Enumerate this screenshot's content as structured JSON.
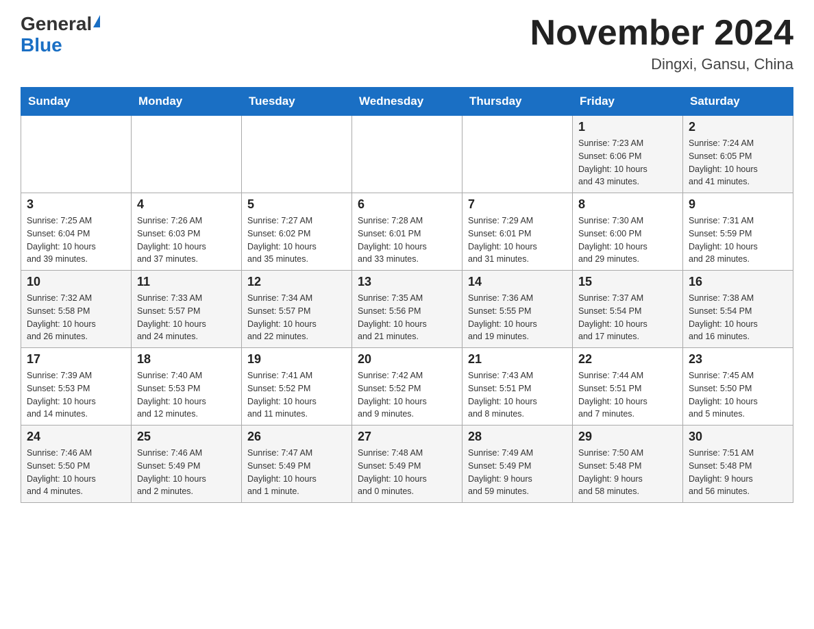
{
  "header": {
    "logo_general": "General",
    "logo_blue": "Blue",
    "month_title": "November 2024",
    "location": "Dingxi, Gansu, China"
  },
  "weekdays": [
    "Sunday",
    "Monday",
    "Tuesday",
    "Wednesday",
    "Thursday",
    "Friday",
    "Saturday"
  ],
  "weeks": [
    [
      {
        "day": "",
        "info": ""
      },
      {
        "day": "",
        "info": ""
      },
      {
        "day": "",
        "info": ""
      },
      {
        "day": "",
        "info": ""
      },
      {
        "day": "",
        "info": ""
      },
      {
        "day": "1",
        "info": "Sunrise: 7:23 AM\nSunset: 6:06 PM\nDaylight: 10 hours\nand 43 minutes."
      },
      {
        "day": "2",
        "info": "Sunrise: 7:24 AM\nSunset: 6:05 PM\nDaylight: 10 hours\nand 41 minutes."
      }
    ],
    [
      {
        "day": "3",
        "info": "Sunrise: 7:25 AM\nSunset: 6:04 PM\nDaylight: 10 hours\nand 39 minutes."
      },
      {
        "day": "4",
        "info": "Sunrise: 7:26 AM\nSunset: 6:03 PM\nDaylight: 10 hours\nand 37 minutes."
      },
      {
        "day": "5",
        "info": "Sunrise: 7:27 AM\nSunset: 6:02 PM\nDaylight: 10 hours\nand 35 minutes."
      },
      {
        "day": "6",
        "info": "Sunrise: 7:28 AM\nSunset: 6:01 PM\nDaylight: 10 hours\nand 33 minutes."
      },
      {
        "day": "7",
        "info": "Sunrise: 7:29 AM\nSunset: 6:01 PM\nDaylight: 10 hours\nand 31 minutes."
      },
      {
        "day": "8",
        "info": "Sunrise: 7:30 AM\nSunset: 6:00 PM\nDaylight: 10 hours\nand 29 minutes."
      },
      {
        "day": "9",
        "info": "Sunrise: 7:31 AM\nSunset: 5:59 PM\nDaylight: 10 hours\nand 28 minutes."
      }
    ],
    [
      {
        "day": "10",
        "info": "Sunrise: 7:32 AM\nSunset: 5:58 PM\nDaylight: 10 hours\nand 26 minutes."
      },
      {
        "day": "11",
        "info": "Sunrise: 7:33 AM\nSunset: 5:57 PM\nDaylight: 10 hours\nand 24 minutes."
      },
      {
        "day": "12",
        "info": "Sunrise: 7:34 AM\nSunset: 5:57 PM\nDaylight: 10 hours\nand 22 minutes."
      },
      {
        "day": "13",
        "info": "Sunrise: 7:35 AM\nSunset: 5:56 PM\nDaylight: 10 hours\nand 21 minutes."
      },
      {
        "day": "14",
        "info": "Sunrise: 7:36 AM\nSunset: 5:55 PM\nDaylight: 10 hours\nand 19 minutes."
      },
      {
        "day": "15",
        "info": "Sunrise: 7:37 AM\nSunset: 5:54 PM\nDaylight: 10 hours\nand 17 minutes."
      },
      {
        "day": "16",
        "info": "Sunrise: 7:38 AM\nSunset: 5:54 PM\nDaylight: 10 hours\nand 16 minutes."
      }
    ],
    [
      {
        "day": "17",
        "info": "Sunrise: 7:39 AM\nSunset: 5:53 PM\nDaylight: 10 hours\nand 14 minutes."
      },
      {
        "day": "18",
        "info": "Sunrise: 7:40 AM\nSunset: 5:53 PM\nDaylight: 10 hours\nand 12 minutes."
      },
      {
        "day": "19",
        "info": "Sunrise: 7:41 AM\nSunset: 5:52 PM\nDaylight: 10 hours\nand 11 minutes."
      },
      {
        "day": "20",
        "info": "Sunrise: 7:42 AM\nSunset: 5:52 PM\nDaylight: 10 hours\nand 9 minutes."
      },
      {
        "day": "21",
        "info": "Sunrise: 7:43 AM\nSunset: 5:51 PM\nDaylight: 10 hours\nand 8 minutes."
      },
      {
        "day": "22",
        "info": "Sunrise: 7:44 AM\nSunset: 5:51 PM\nDaylight: 10 hours\nand 7 minutes."
      },
      {
        "day": "23",
        "info": "Sunrise: 7:45 AM\nSunset: 5:50 PM\nDaylight: 10 hours\nand 5 minutes."
      }
    ],
    [
      {
        "day": "24",
        "info": "Sunrise: 7:46 AM\nSunset: 5:50 PM\nDaylight: 10 hours\nand 4 minutes."
      },
      {
        "day": "25",
        "info": "Sunrise: 7:46 AM\nSunset: 5:49 PM\nDaylight: 10 hours\nand 2 minutes."
      },
      {
        "day": "26",
        "info": "Sunrise: 7:47 AM\nSunset: 5:49 PM\nDaylight: 10 hours\nand 1 minute."
      },
      {
        "day": "27",
        "info": "Sunrise: 7:48 AM\nSunset: 5:49 PM\nDaylight: 10 hours\nand 0 minutes."
      },
      {
        "day": "28",
        "info": "Sunrise: 7:49 AM\nSunset: 5:49 PM\nDaylight: 9 hours\nand 59 minutes."
      },
      {
        "day": "29",
        "info": "Sunrise: 7:50 AM\nSunset: 5:48 PM\nDaylight: 9 hours\nand 58 minutes."
      },
      {
        "day": "30",
        "info": "Sunrise: 7:51 AM\nSunset: 5:48 PM\nDaylight: 9 hours\nand 56 minutes."
      }
    ]
  ]
}
